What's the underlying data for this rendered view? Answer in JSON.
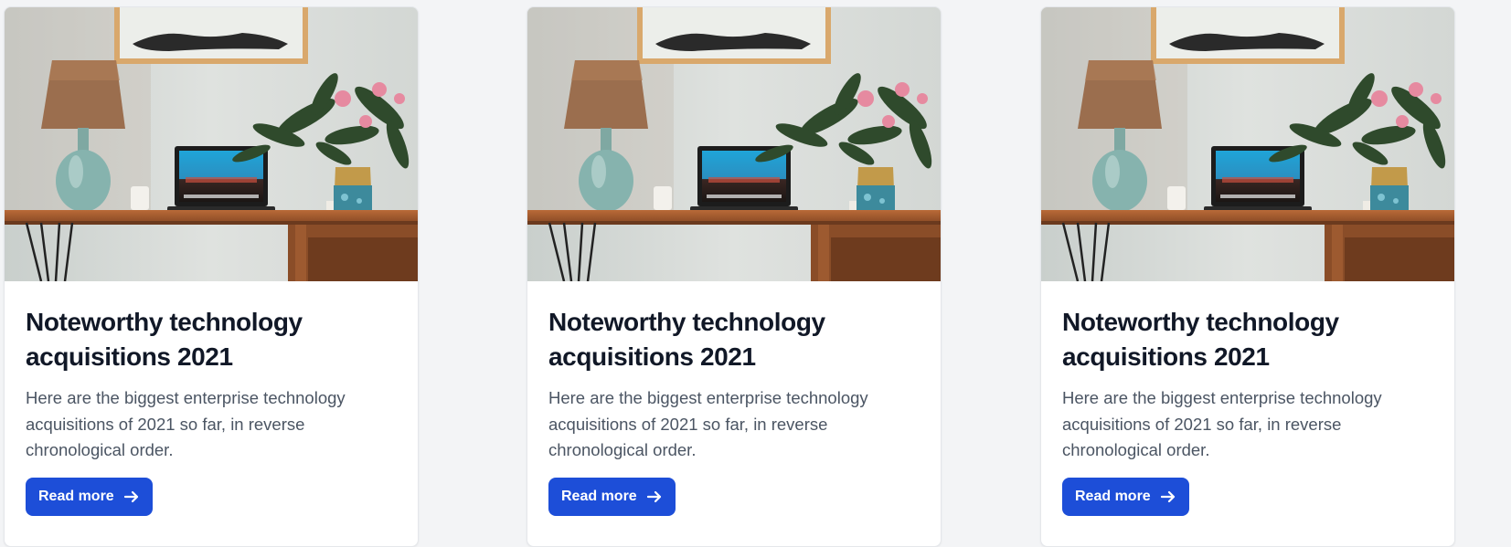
{
  "cards": [
    {
      "title": "Noteworthy technology acquisitions 2021",
      "description": "Here are the biggest enterprise technology acquisitions of 2021 so far, in reverse chronological order.",
      "button_label": "Read more",
      "button_icon": "arrow-right-icon"
    },
    {
      "title": "Noteworthy technology acquisitions 2021",
      "description": "Here are the biggest enterprise technology acquisitions of 2021 so far, in reverse chronological order.",
      "button_label": "Read more",
      "button_icon": "arrow-right-icon"
    },
    {
      "title": "Noteworthy technology acquisitions 2021",
      "description": "Here are the biggest enterprise technology acquisitions of 2021 so far, in reverse chronological order.",
      "button_label": "Read more",
      "button_icon": "arrow-right-icon"
    }
  ],
  "colors": {
    "page_background": "#f3f4f6",
    "card_background": "#ffffff",
    "title_text": "#111827",
    "body_text": "#4b5563",
    "button_background": "#1d4ed8",
    "button_text": "#ffffff"
  }
}
